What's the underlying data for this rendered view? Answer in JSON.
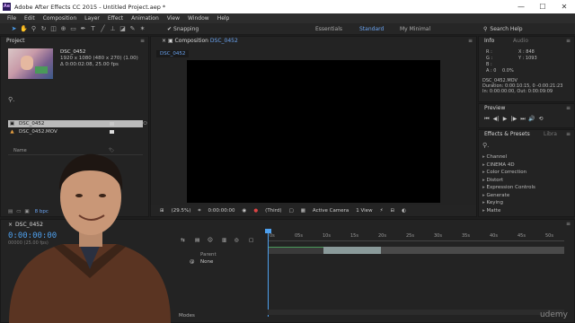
{
  "titlebar": {
    "app_icon": "Ae",
    "title": "Adobe After Effects CC 2015 - Untitled Project.aep *"
  },
  "menu": [
    "File",
    "Edit",
    "Composition",
    "Layer",
    "Effect",
    "Animation",
    "View",
    "Window",
    "Help"
  ],
  "toolbar": {
    "snapping_label": "Snapping",
    "workspaces": [
      "Essentials",
      "Standard",
      "My Minimal"
    ],
    "active_workspace": "Standard",
    "search_placeholder": "Search Help"
  },
  "project": {
    "tab": "Project",
    "footage_name": "DSC_0452",
    "footage_dims": "1920 x 1080 (480 x 270) (1.00)",
    "footage_duration": "Δ 0:00:02:08, 25.00 fps",
    "column_name": "Name",
    "items": [
      {
        "name": "DSC_0452",
        "type": "composition",
        "selected": true
      },
      {
        "name": "DSC_0452.MOV",
        "type": "footage",
        "selected": false
      }
    ],
    "footer_bpc": "8 bpc"
  },
  "composition": {
    "panel_label": "Composition",
    "comp_name": "DSC_0452",
    "chip_label": "DSC_0452",
    "zoom": "(29.5%)",
    "timecode": "0:00:00:00",
    "resolution": "(Third)",
    "camera": "Active Camera",
    "views": "1 View"
  },
  "info": {
    "tab": "Info",
    "tab2": "Audio",
    "r": "R :",
    "g": "G :",
    "b": "B :",
    "a": "A : 0",
    "x": "X : 848",
    "y": "Y : 1093",
    "alpha_pct": "0.0%",
    "file": "DSC_0452.MOV",
    "duration": "Duration: 0:00:10:15, 0 -0:00:21:23",
    "in_out": "In: 0:00:00:00, Out: 0:00:09:09"
  },
  "preview": {
    "tab": "Preview",
    "controls": [
      "⏮",
      "◀|",
      "▶",
      "|▶",
      "⏭",
      "🔊",
      "⟲"
    ]
  },
  "effects": {
    "tab": "Effects & Presets",
    "tab2": "Libra",
    "categories": [
      "Channel",
      "CINEMA 4D",
      "Color Correction",
      "Distort",
      "Expression Controls",
      "Generate",
      "Keying",
      "Matte"
    ]
  },
  "timeline": {
    "tab": "DSC_0452",
    "timecode": "0:00:00:00",
    "timecode_sub": "00000 (25.00 fps)",
    "parent_label": "Parent",
    "parent_value": "None",
    "modes_label": "Modes",
    "ruler": [
      "0s",
      "05s",
      "10s",
      "15s",
      "20s",
      "25s",
      "30s",
      "35s",
      "40s",
      "45s",
      "50s"
    ]
  },
  "watermark": "udemy",
  "colors": {
    "accent": "#4ea0ee",
    "panel_bg": "#232323",
    "track_green": "#4a9a5a",
    "track_gray": "#8a9a9a"
  }
}
